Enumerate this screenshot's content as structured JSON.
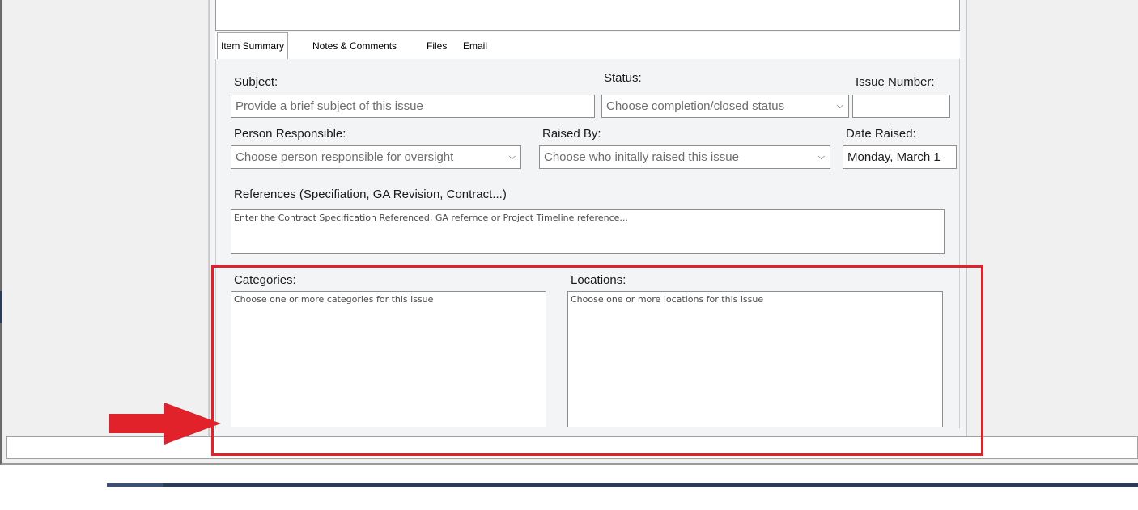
{
  "tabs": [
    {
      "label": "Item Summary",
      "active": true
    },
    {
      "label": "Notes & Comments",
      "active": false
    },
    {
      "label": "Files",
      "active": false
    },
    {
      "label": "Email",
      "active": false
    }
  ],
  "form": {
    "subject": {
      "label": "Subject:",
      "placeholder": "Provide a brief subject of this issue"
    },
    "status": {
      "label": "Status:",
      "placeholder": "Choose completion/closed status"
    },
    "issue_number": {
      "label": "Issue Number:",
      "value": ""
    },
    "person_responsible": {
      "label": "Person Responsible:",
      "placeholder": "Choose person responsible for oversight"
    },
    "raised_by": {
      "label": "Raised By:",
      "placeholder": "Choose who initally raised this issue"
    },
    "date_raised": {
      "label": "Date Raised:",
      "value": "Monday, March 1"
    },
    "references": {
      "label": "References (Specifiation, GA Revision, Contract...)",
      "placeholder": "Enter the Contract Specification Referenced, GA refernce or Project Timeline reference..."
    },
    "categories": {
      "label": "Categories:",
      "placeholder": "Choose one or more categories for this issue"
    },
    "locations": {
      "label": "Locations:",
      "placeholder": "Choose one or more locations for this issue"
    }
  },
  "icons": {
    "dropdown": "chevron-down-icon"
  },
  "colors": {
    "highlight": "#e2222a",
    "panel_bg": "#f3f4f6"
  }
}
